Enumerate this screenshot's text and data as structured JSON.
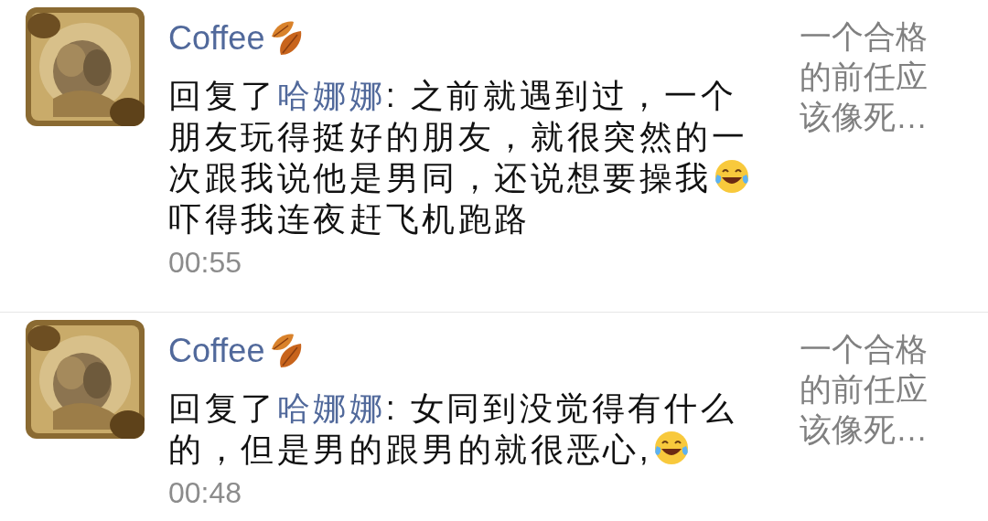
{
  "notifications": [
    {
      "user": "Coffee",
      "reply_prefix": "回复了",
      "reply_to": "哈娜娜",
      "segments": [
        {
          "kind": "text",
          "text": ": 之前就遇到过，一个朋友玩得挺好的朋友，就很突然的一次跟我说他是男同，还说想要操我"
        },
        {
          "kind": "emoji"
        },
        {
          "kind": "text",
          "text": "吓得我连夜赶飞机跑路"
        }
      ],
      "time": "00:55",
      "original_post": "一个合格的前任应该像死…"
    },
    {
      "user": "Coffee",
      "reply_prefix": "回复了",
      "reply_to": "哈娜娜",
      "segments": [
        {
          "kind": "text",
          "text": ": 女同到没觉得有什么的，但是男的跟男的就很恶心,"
        },
        {
          "kind": "emoji"
        }
      ],
      "time": "00:48",
      "original_post": "一个合格的前任应该像死…"
    }
  ]
}
